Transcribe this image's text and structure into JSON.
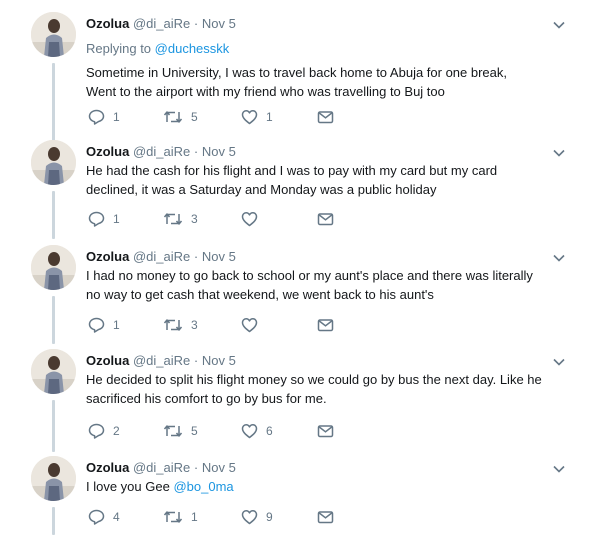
{
  "tweets": [
    {
      "name": "Ozolua",
      "handle": "@di_aiRe",
      "separator": "·",
      "time": "Nov 5",
      "replying_prefix": "Replying to",
      "replying_to": "@duchesskk",
      "text": "Sometime in University, I was to travel back home to Abuja for one break,\nWent to the airport with my friend who was travelling to Buj too",
      "text_suffix": "",
      "replies": "1",
      "retweets": "5",
      "likes": "1"
    },
    {
      "name": "Ozolua",
      "handle": "@di_aiRe",
      "separator": "·",
      "time": "Nov 5",
      "text": "He had the cash for his flight and I was to pay with my card but my card\ndeclined, it was a Saturday and Monday was a public holiday",
      "text_suffix": "",
      "replies": "1",
      "retweets": "3",
      "likes": ""
    },
    {
      "name": "Ozolua",
      "handle": "@di_aiRe",
      "separator": "·",
      "time": "Nov 5",
      "text": "I had no money to go back to school or my aunt's place and there was literally\nno way to get cash that weekend, we went back to his aunt's",
      "text_suffix": "",
      "replies": "1",
      "retweets": "3",
      "likes": ""
    },
    {
      "name": "Ozolua",
      "handle": "@di_aiRe",
      "separator": "·",
      "time": "Nov 5",
      "text": "He decided to split his flight money so we could go by bus the next day. Like he\nsacrificed his comfort to go by bus for me.",
      "text_suffix": "",
      "replies": "2",
      "retweets": "5",
      "likes": "6"
    },
    {
      "name": "Ozolua",
      "handle": "@di_aiRe",
      "separator": "·",
      "time": "Nov 5",
      "text": "I love you Gee ",
      "text_suffix": "@bo_0ma",
      "replies": "4",
      "retweets": "1",
      "likes": "9"
    }
  ],
  "icons": {
    "reply": "reply-icon",
    "retweet": "retweet-icon",
    "like": "heart-icon",
    "dm": "envelope-icon",
    "caret": "chevron-down-icon"
  },
  "colors": {
    "text": "#14171a",
    "secondary": "#657786",
    "link": "#1b95e0",
    "thread_line": "#ccd6dd"
  }
}
